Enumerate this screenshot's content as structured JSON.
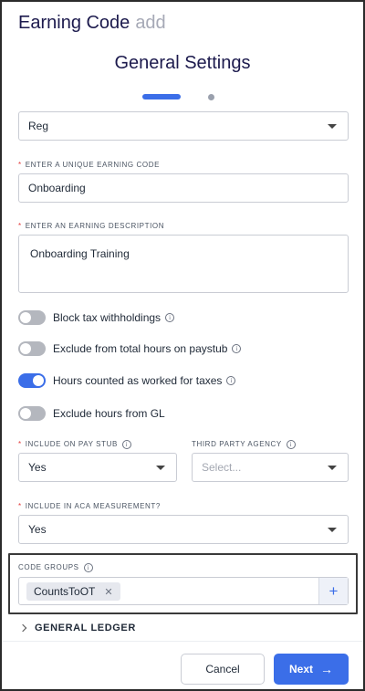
{
  "header": {
    "title": "Earning Code",
    "subtitle": "add"
  },
  "section": {
    "title": "General Settings"
  },
  "stepper": {
    "current_step": 1,
    "total_steps": 2
  },
  "earning_type": {
    "value": "Reg"
  },
  "unique_code": {
    "label": "ENTER A UNIQUE EARNING CODE",
    "value": "Onboarding"
  },
  "description": {
    "label": "ENTER AN EARNING DESCRIPTION",
    "value": "Onboarding Training"
  },
  "toggles": [
    {
      "label": "Block tax withholdings",
      "on": false,
      "info": true
    },
    {
      "label": "Exclude from total hours on paystub",
      "on": false,
      "info": true
    },
    {
      "label": "Hours counted as worked for taxes",
      "on": true,
      "info": true
    },
    {
      "label": "Exclude hours from GL",
      "on": false,
      "info": false
    }
  ],
  "pay_stub": {
    "label": "INCLUDE ON PAY STUB",
    "value": "Yes"
  },
  "third_party": {
    "label": "THIRD PARTY AGENCY",
    "placeholder": "Select..."
  },
  "aca": {
    "label": "INCLUDE IN ACA MEASUREMENT?",
    "value": "Yes"
  },
  "code_groups": {
    "label": "CODE GROUPS",
    "chips": [
      "CountsToOT"
    ],
    "chip_remove": "✕",
    "add": "+"
  },
  "general_ledger": {
    "label": "GENERAL LEDGER"
  },
  "footer": {
    "cancel_label": "Cancel",
    "next_label": "Next",
    "next_arrow": "→"
  },
  "colors": {
    "accent": "#3b6ee8",
    "title": "#1c1a4d",
    "required": "#e23b3b"
  }
}
